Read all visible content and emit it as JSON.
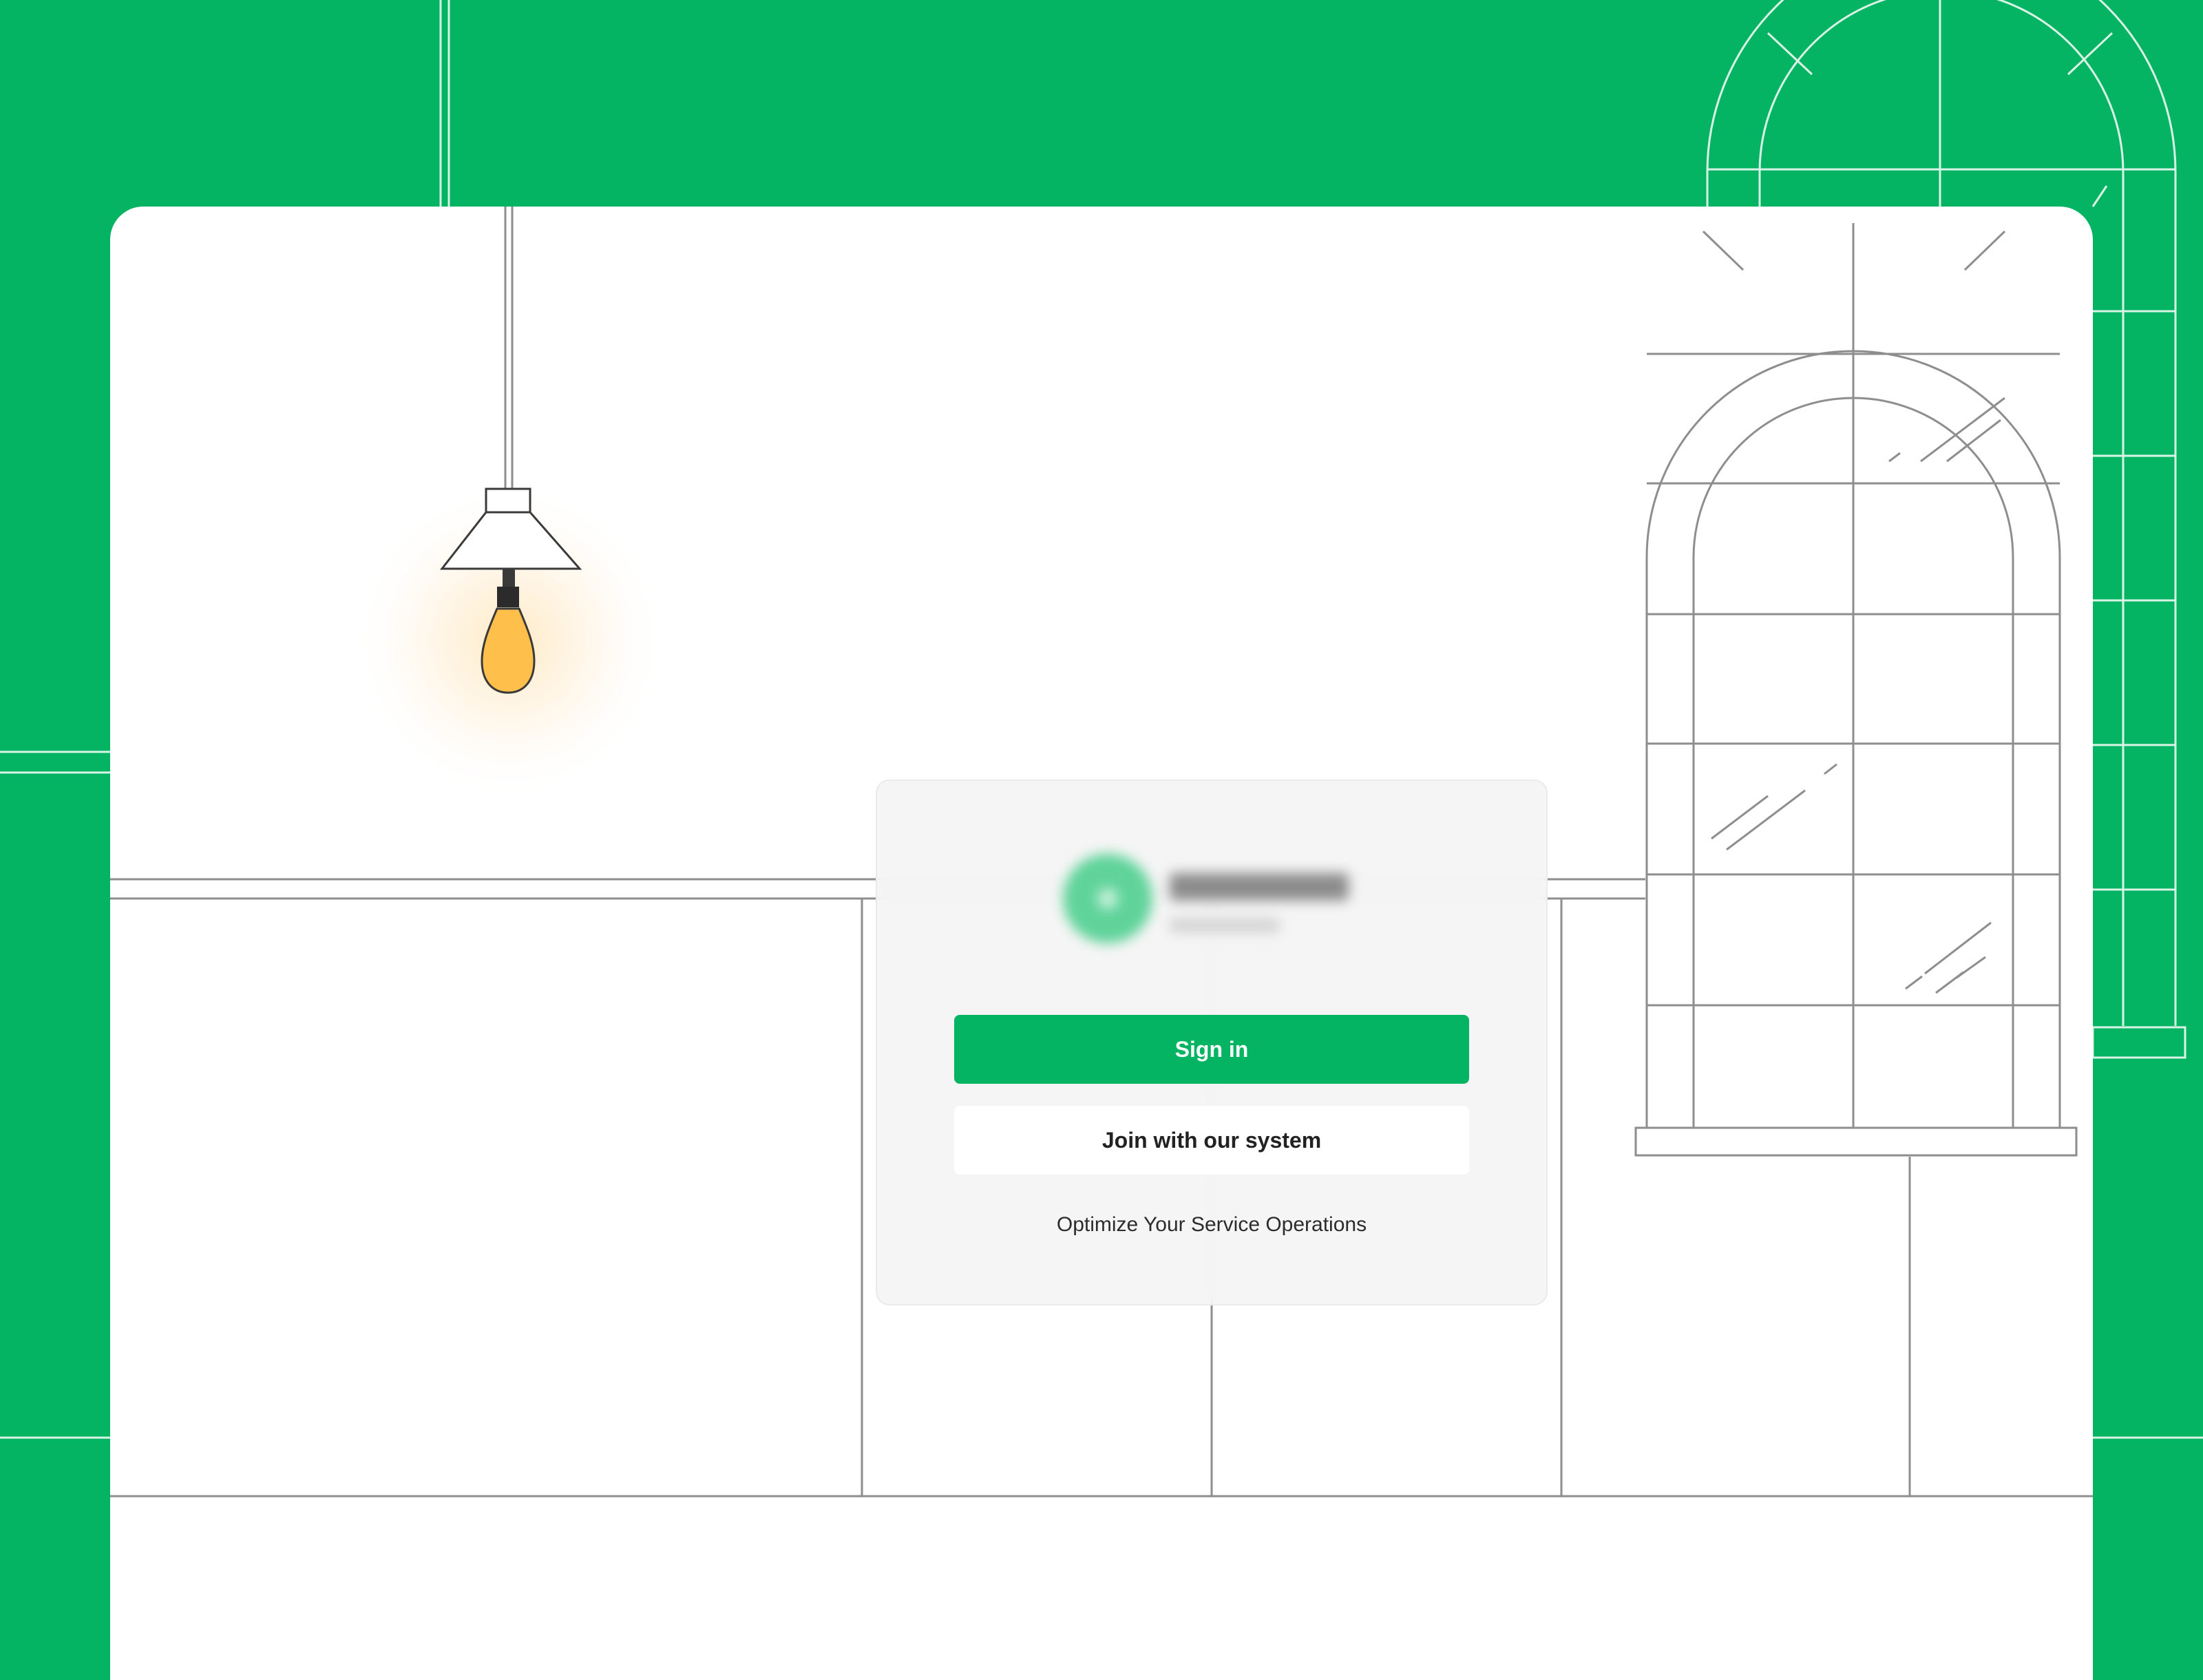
{
  "brand": {
    "logo_text": "",
    "note": ""
  },
  "login": {
    "sign_in_label": "Sign in",
    "join_label": "Join with our system",
    "tagline": "Optimize Your Service Operations"
  },
  "colors": {
    "brand_green": "#05b462",
    "panel": "#ffffff",
    "bulb": "#ffbf4a",
    "line": "#8e8e8e"
  },
  "icons": [
    "pendant-lamp-icon",
    "light-bulb-icon",
    "arched-window-icon"
  ]
}
